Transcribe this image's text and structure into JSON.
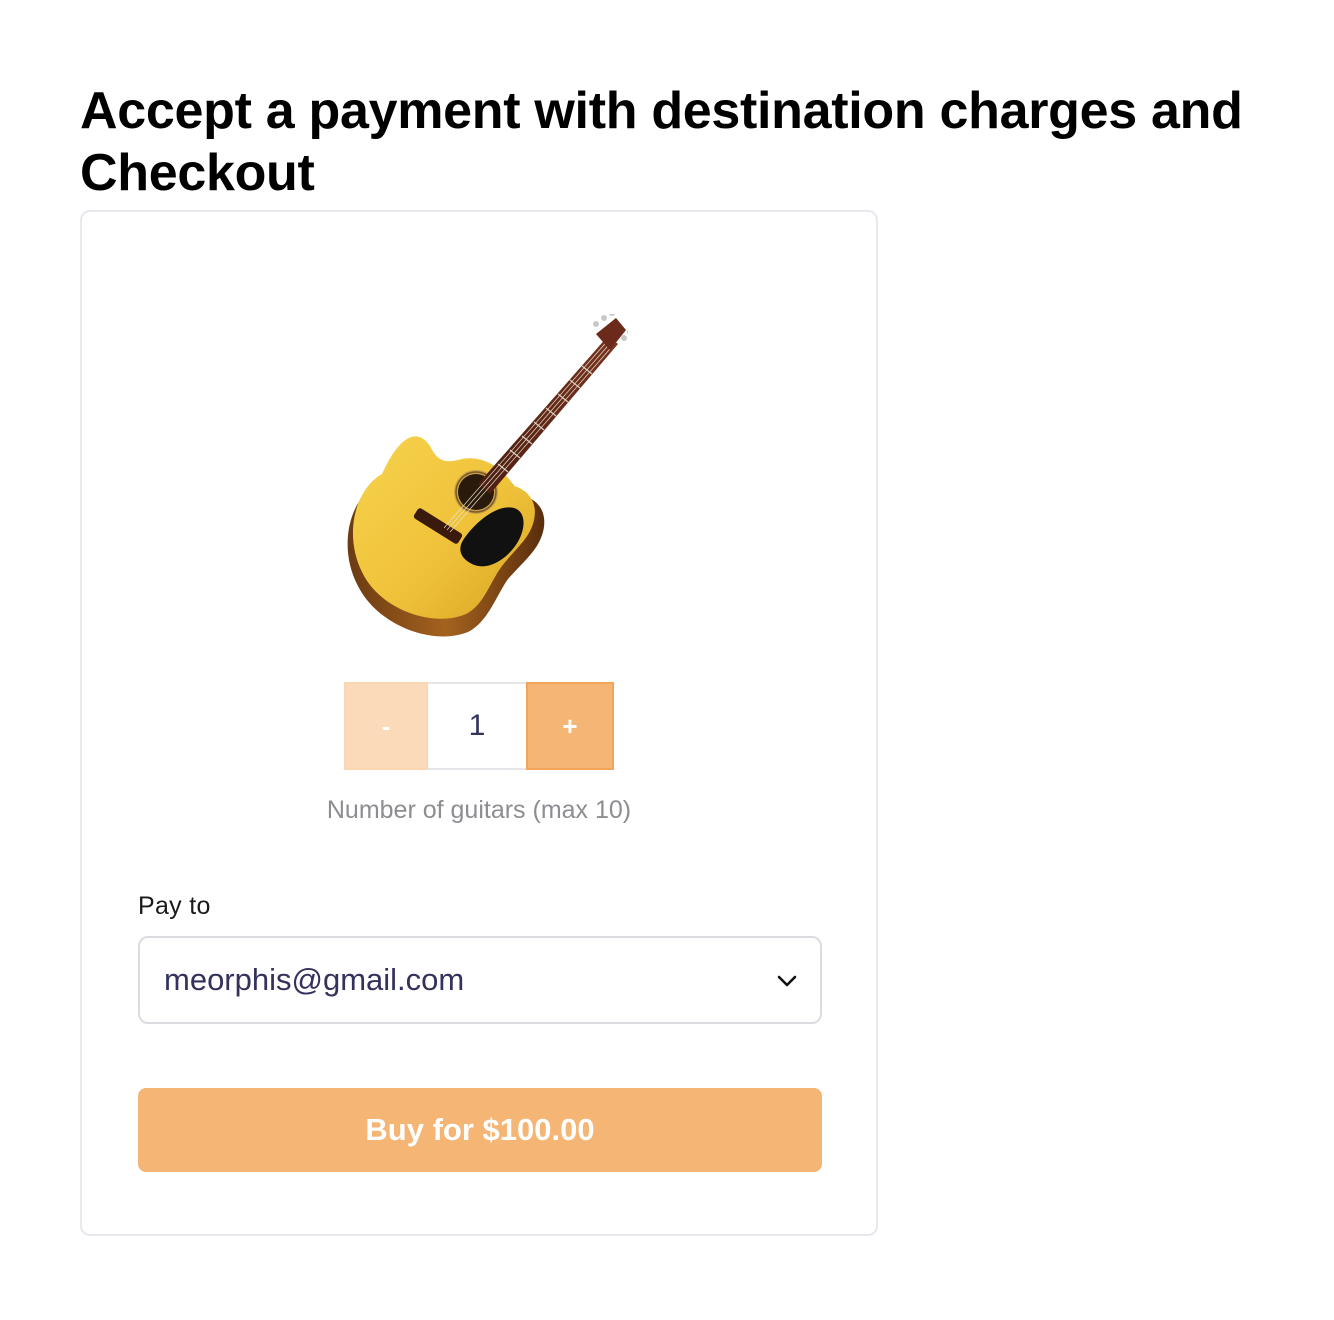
{
  "page": {
    "title": "Accept a payment with destination charges and Checkout"
  },
  "product": {
    "image_icon": "acoustic-guitar-image"
  },
  "quantity": {
    "decrement_label": "-",
    "value": "1",
    "increment_label": "+",
    "help_text": "Number of guitars (max 10)"
  },
  "pay_to": {
    "label": "Pay to",
    "selected_value": "meorphis@gmail.com",
    "icon": "chevron-down-icon"
  },
  "checkout": {
    "buy_label": "Buy for $100.00"
  },
  "colors": {
    "accent": "#f4b575",
    "accent_light": "#fbdab9",
    "text_dark": "#32325d",
    "muted": "#8d8d92"
  }
}
